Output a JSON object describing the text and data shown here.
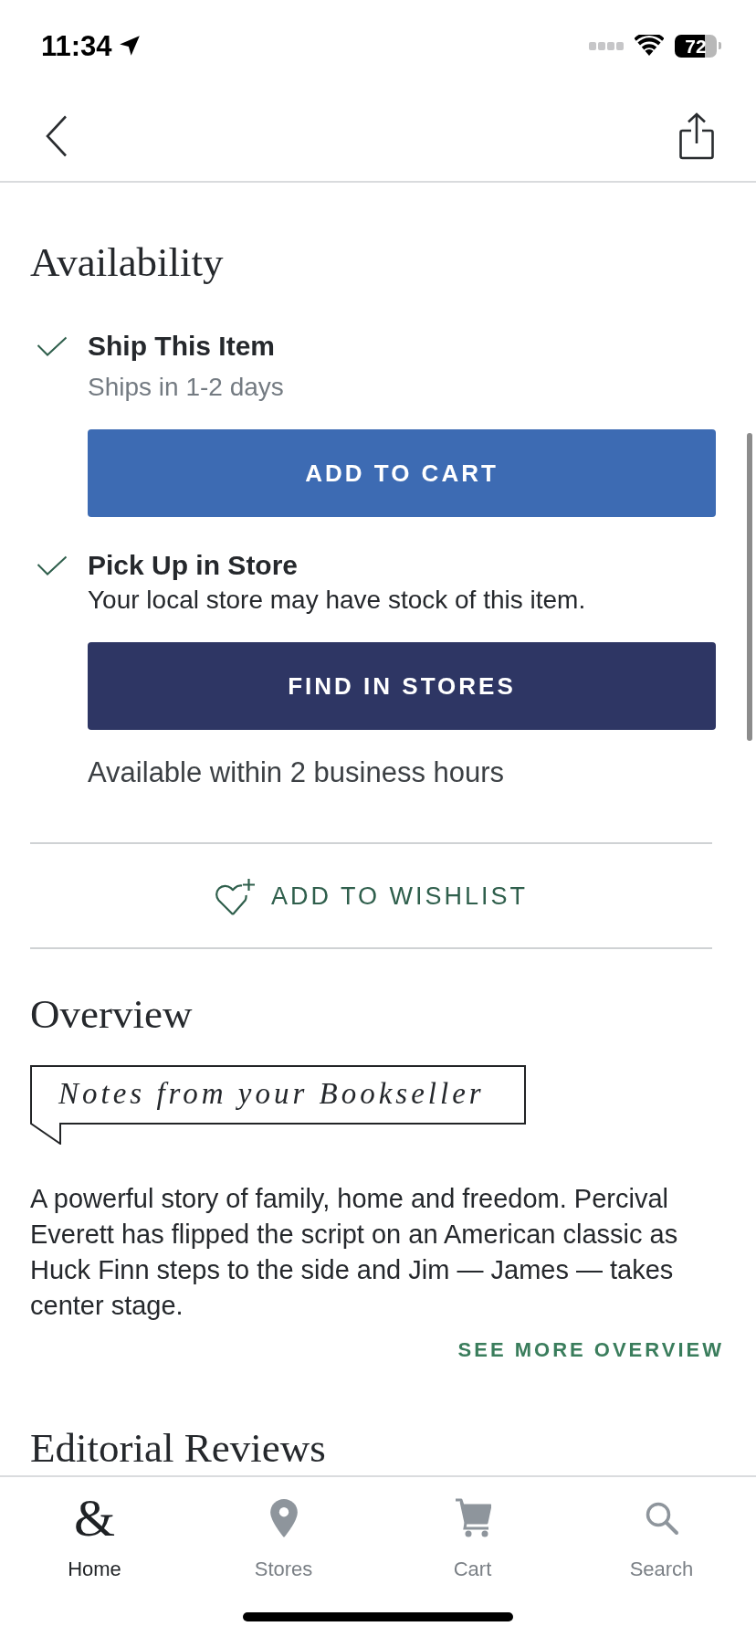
{
  "status_bar": {
    "time": "11:34",
    "battery": "72"
  },
  "availability": {
    "title": "Availability",
    "options": [
      {
        "kind": "ship",
        "checked": true,
        "title": "Ship This Item",
        "subtitle": "Ships in 1-2 days",
        "button": "ADD TO CART"
      },
      {
        "kind": "pickup",
        "checked": true,
        "title": "Pick Up in Store",
        "subtitle": "Your local store may have stock of this item.",
        "button": "FIND IN STORES",
        "note": "Available within 2 business hours"
      }
    ]
  },
  "wishlist": {
    "label": "ADD TO WISHLIST"
  },
  "overview": {
    "title": "Overview",
    "tag": "Notes from your Bookseller",
    "text": "A powerful story of family, home and freedom. Percival Everett has flipped the script on an American classic as Huck Finn steps to the side and Jim — James — takes center stage.",
    "link": "SEE MORE OVERVIEW"
  },
  "editorial_reviews": {
    "title": "Editorial Reviews"
  },
  "tabs": [
    {
      "glyph": "&",
      "label": "Home",
      "selected": true
    },
    {
      "label": "Stores",
      "selected": false
    },
    {
      "label": "Cart",
      "selected": false
    },
    {
      "label": "Search",
      "selected": false
    }
  ]
}
